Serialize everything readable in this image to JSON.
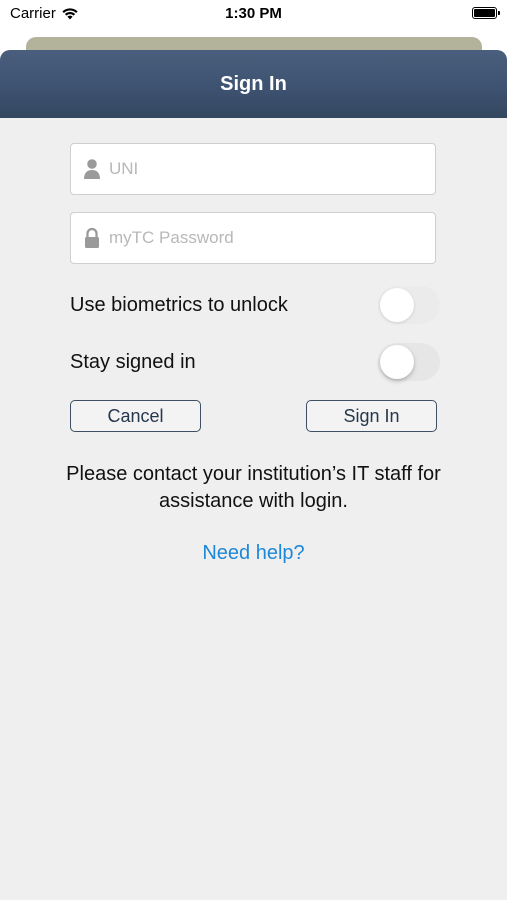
{
  "status_bar": {
    "carrier": "Carrier",
    "time": "1:30 PM",
    "wifi_icon": "wifi-icon",
    "battery_icon": "battery-icon"
  },
  "nav": {
    "title": "Sign In"
  },
  "form": {
    "uni": {
      "placeholder": "UNI",
      "value": "",
      "icon": "person-icon"
    },
    "password": {
      "placeholder": "myTC Password",
      "value": "",
      "icon": "lock-icon"
    },
    "biometrics": {
      "label": "Use biometrics to unlock",
      "on": false,
      "enabled": false
    },
    "stay_signed_in": {
      "label": "Stay signed in",
      "on": false,
      "enabled": true
    },
    "cancel_label": "Cancel",
    "sign_in_label": "Sign In"
  },
  "info": {
    "message": "Please contact your institution’s IT staff for assistance with login."
  },
  "help": {
    "link_label": "Need help?"
  },
  "colors": {
    "nav_bar": "#3d5170",
    "link": "#1e88d8",
    "sheet_background": "#efefef",
    "button_border": "#3e4f63"
  }
}
